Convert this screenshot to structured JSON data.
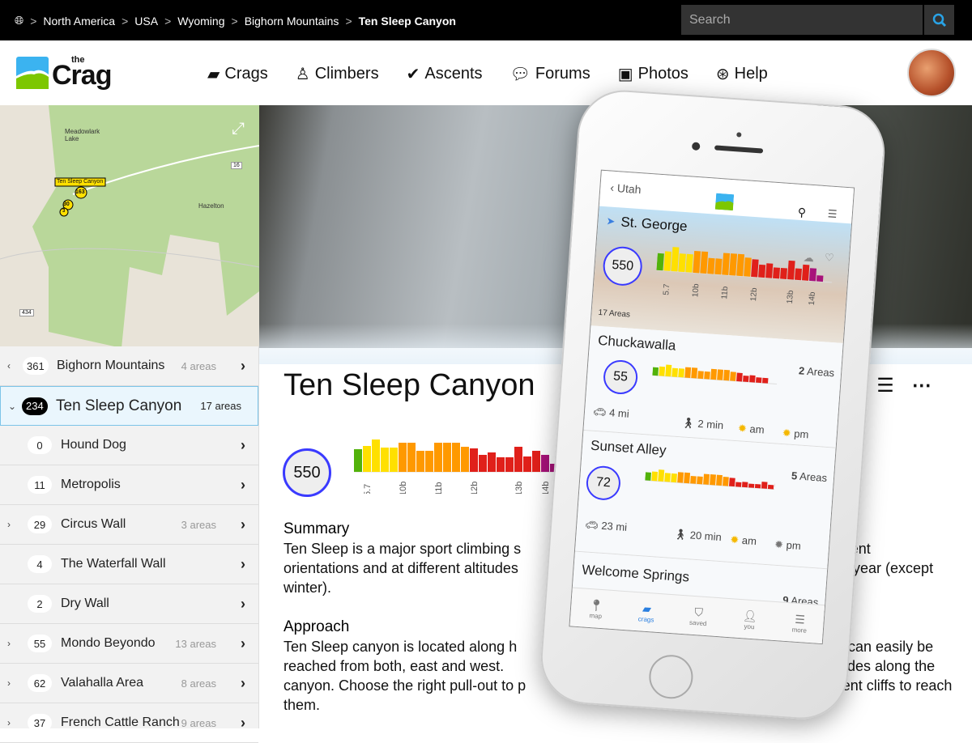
{
  "breadcrumb": {
    "items": [
      "North America",
      "USA",
      "Wyoming",
      "Bighorn Mountains"
    ],
    "current": "Ten Sleep Canyon"
  },
  "search": {
    "placeholder": "Search"
  },
  "nav": [
    {
      "label": "Crags",
      "icon": "book-icon"
    },
    {
      "label": "Climbers",
      "icon": "user-icon"
    },
    {
      "label": "Ascents",
      "icon": "check-icon"
    },
    {
      "label": "Forums",
      "icon": "chat-icon"
    },
    {
      "label": "Photos",
      "icon": "image-icon"
    },
    {
      "label": "Help",
      "icon": "lifebuoy-icon"
    }
  ],
  "logo": {
    "text_top": "the",
    "text": "Crag"
  },
  "map": {
    "labels": [
      "Meadowlark Lake",
      "Ten Sleep Canyon",
      "Hazelton",
      "16",
      "434"
    ],
    "markers": [
      "163",
      "30",
      "3"
    ]
  },
  "sidebar": {
    "parent": {
      "count": "361",
      "name": "Bighorn Mountains",
      "areas": "4 areas"
    },
    "active": {
      "count": "234",
      "name": "Ten Sleep Canyon",
      "areas": "17 areas"
    },
    "items": [
      {
        "count": "0",
        "name": "Hound Dog",
        "areas": "",
        "expand": false
      },
      {
        "count": "11",
        "name": "Metropolis",
        "areas": "",
        "expand": false
      },
      {
        "count": "29",
        "name": "Circus Wall",
        "areas": "3 areas",
        "expand": true
      },
      {
        "count": "4",
        "name": "The Waterfall Wall",
        "areas": "",
        "expand": false
      },
      {
        "count": "2",
        "name": "Dry Wall",
        "areas": "",
        "expand": false
      },
      {
        "count": "55",
        "name": "Mondo Beyondo",
        "areas": "13 areas",
        "expand": true
      },
      {
        "count": "62",
        "name": "Valahalla Area",
        "areas": "8 areas",
        "expand": true
      },
      {
        "count": "37",
        "name": "French Cattle Ranch",
        "areas": "9 areas",
        "expand": true
      }
    ]
  },
  "page": {
    "title": "Ten Sleep Canyon",
    "route_count": "550",
    "summary_h": "Summary",
    "summary": "Ten Sleep is a major sport climbing s... different orientations and at different altitudes ... f the year (except winter).",
    "summary_lines": [
      "Ten Sleep is a major sport climbing s",
      "different",
      "orientations and at different altitudes",
      "f the year (except",
      "winter)."
    ],
    "approach_h": "Approach",
    "approach_lines": [
      "Ten Sleep canyon is located along h",
      "and can easily be",
      "reached from both, east and west.",
      "n sides along the",
      "canyon. Choose the right pull-out to p",
      "different cliffs to reach",
      "them."
    ]
  },
  "colors": {
    "accent": "#3a3aff",
    "green": "#52b20a",
    "yellow": "#ffe000",
    "orange": "#ff9900",
    "red": "#e0201a",
    "purple": "#a8127a",
    "heart": "#e0201a"
  },
  "chart_data": {
    "type": "bar",
    "ticks": [
      "5.7",
      "10b",
      "11b",
      "12b",
      "13b",
      "14b"
    ],
    "values": [
      28,
      32,
      40,
      30,
      30,
      36,
      36,
      26,
      26,
      36,
      36,
      36,
      31,
      29,
      21,
      24,
      18,
      18,
      31,
      19,
      26,
      21,
      10
    ],
    "bands": [
      "green",
      "yellow",
      "yellow",
      "yellow",
      "yellow",
      "orange",
      "orange",
      "orange",
      "orange",
      "orange",
      "orange",
      "orange",
      "orange",
      "red",
      "red",
      "red",
      "red",
      "red",
      "red",
      "red",
      "red",
      "purple",
      "purple"
    ]
  },
  "phone": {
    "back": "Utah",
    "header": {
      "name": "St. George",
      "count": "550",
      "areas": "17 Areas"
    },
    "cards": [
      {
        "name": "Chuckawalla",
        "areas_n": "2",
        "areas": "Areas",
        "count": "55",
        "drive": "4 mi",
        "walk": "2 min",
        "am": "am",
        "pm": "pm"
      },
      {
        "name": "Sunset Alley",
        "areas_n": "5",
        "areas": "Areas",
        "count": "72",
        "drive": "23 mi",
        "walk": "20 min",
        "am": "am",
        "pm": "pm"
      },
      {
        "name": "Welcome Springs",
        "areas_n": "9",
        "areas": "Areas"
      }
    ],
    "tabs": [
      {
        "label": "map",
        "icon": "pin-icon"
      },
      {
        "label": "crags",
        "icon": "book-icon",
        "active": true
      },
      {
        "label": "saved",
        "icon": "bookmark-icon"
      },
      {
        "label": "you",
        "icon": "user-icon"
      },
      {
        "label": "more",
        "icon": "menu-icon"
      }
    ]
  }
}
